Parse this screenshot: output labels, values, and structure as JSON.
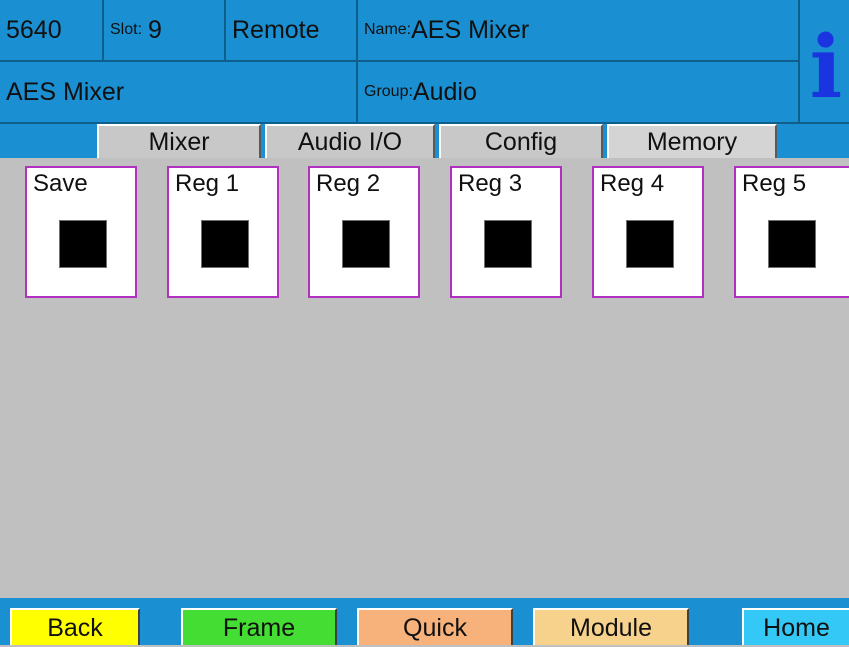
{
  "header": {
    "model": "5640",
    "slot_label": "Slot:",
    "slot_value": "9",
    "mode": "Remote",
    "name_label": "Name:",
    "name_value": "AES Mixer",
    "module_type": "AES Mixer",
    "group_label": "Group:",
    "group_value": "Audio",
    "info_glyph": "i",
    "info_color": "#1a34e0",
    "bg_color": "#1a8fd1"
  },
  "tabs": [
    {
      "label": "Mixer",
      "active": false
    },
    {
      "label": "Audio I/O",
      "active": false
    },
    {
      "label": "Config",
      "active": false
    },
    {
      "label": "Memory",
      "active": true
    }
  ],
  "memory_slots": [
    {
      "label": "Save"
    },
    {
      "label": "Reg 1"
    },
    {
      "label": "Reg 2"
    },
    {
      "label": "Reg 3"
    },
    {
      "label": "Reg 4"
    },
    {
      "label": "Reg 5"
    }
  ],
  "footer": {
    "buttons": [
      {
        "label": "Back",
        "color": "#ffff00"
      },
      {
        "label": "Frame",
        "color": "#44dd33"
      },
      {
        "label": "Quick",
        "color": "#f6b27a"
      },
      {
        "label": "Module",
        "color": "#f7d28c"
      },
      {
        "label": "Home",
        "color": "#33c8f5"
      }
    ]
  },
  "colors": {
    "slot_border": "#b030c0",
    "content_bg": "#c0c0c0"
  }
}
